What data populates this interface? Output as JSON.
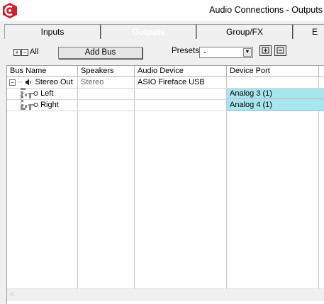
{
  "window": {
    "title": "Audio Connections - Outputs"
  },
  "tabs": [
    {
      "label": "Inputs",
      "active": false
    },
    {
      "label": "Outputs",
      "active": true
    },
    {
      "label": "Group/FX",
      "active": false
    },
    {
      "label": "E",
      "active": false
    }
  ],
  "toolbar": {
    "expand_icon": "plus-box",
    "collapse_icon": "minus-box",
    "all_label": "All",
    "add_bus_label": "Add Bus",
    "presets_label": "Presets",
    "presets_value": "-"
  },
  "table": {
    "columns": [
      "Bus Name",
      "Speakers",
      "Audio Device",
      "Device Port"
    ],
    "rows": [
      {
        "name": "Stereo Out",
        "speakers": "Stereo",
        "device": "ASIO Fireface USB",
        "port": ""
      },
      {
        "name": "Left",
        "speakers": "",
        "device": "",
        "port": "Analog 3 (1)"
      },
      {
        "name": "Right",
        "speakers": "",
        "device": "",
        "port": "Analog 4 (1)"
      }
    ]
  },
  "colors": {
    "port_highlight": "#a8e6ef",
    "app_icon": "#c8102e"
  }
}
